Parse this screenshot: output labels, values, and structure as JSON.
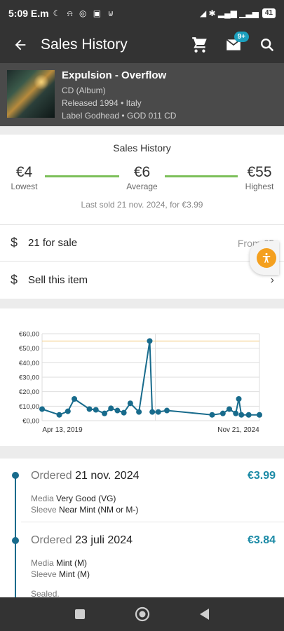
{
  "status": {
    "time": "5:09 E.m",
    "indicators": "☾ ⍾ ◎ ▣ ⊍",
    "signal": "◢ ✱ ▂▄▆ ▁▃▅",
    "battery": "41"
  },
  "appbar": {
    "title": "Sales History",
    "messages_badge": "9+",
    "icons": [
      "back-arrow-icon",
      "cart-icon",
      "mail-icon",
      "search-icon"
    ]
  },
  "release": {
    "title": "Expulsion - Overflow",
    "format": "CD (Album)",
    "released": "Released 1994 • Italy",
    "label": "Label Godhead • GOD 011 CD"
  },
  "summary": {
    "heading": "Sales History",
    "lowest_value": "€4",
    "lowest_label": "Lowest",
    "average_value": "€6",
    "average_label": "Average",
    "highest_value": "€55",
    "highest_label": "Highest",
    "last_sold": "Last sold 21 nov. 2024, for €3.99"
  },
  "rows": {
    "for_sale_label": "21 for sale",
    "for_sale_from": "From €5",
    "sell_label": "Sell this item"
  },
  "chart_data": {
    "type": "line",
    "y_ticks": [
      "€60,00",
      "€50,00",
      "€40,00",
      "€30,00",
      "€20,00",
      "€10,00",
      "€0,00"
    ],
    "ylim": [
      0,
      60
    ],
    "x_tick_labels": [
      "Apr 13, 2019",
      "Nov 21, 2024"
    ],
    "reference_line": 55,
    "x": [
      0,
      4,
      6,
      7.5,
      11,
      12.5,
      14.5,
      16,
      17.5,
      19,
      20.5,
      22.5,
      25,
      25.6,
      27,
      29,
      39.5,
      42,
      43.5,
      45,
      45.7,
      46.3,
      48,
      50.5
    ],
    "y": [
      8,
      4,
      6.5,
      15,
      8,
      7.5,
      5,
      8.5,
      7,
      5.5,
      12,
      6,
      55,
      6,
      6,
      7,
      4,
      5,
      8,
      5,
      15,
      4,
      3.99,
      3.99
    ]
  },
  "orders": [
    {
      "prefix": "Ordered",
      "date": "21 nov. 2024",
      "price": "€3.99",
      "media_label": "Media",
      "media": "Very Good (VG)",
      "sleeve_label": "Sleeve",
      "sleeve": "Near Mint (NM or M-)"
    },
    {
      "prefix": "Ordered",
      "date": "23 juli 2024",
      "price": "€3.84",
      "media_label": "Media",
      "media": "Mint (M)",
      "sleeve_label": "Sleeve",
      "sleeve": "Mint (M)",
      "note": "Sealed."
    }
  ],
  "colors": {
    "bar": "#333333",
    "accent": "#1b8aa6",
    "series": "#186b8c",
    "range": "#7cbf5a",
    "fab": "#f4a01f"
  }
}
